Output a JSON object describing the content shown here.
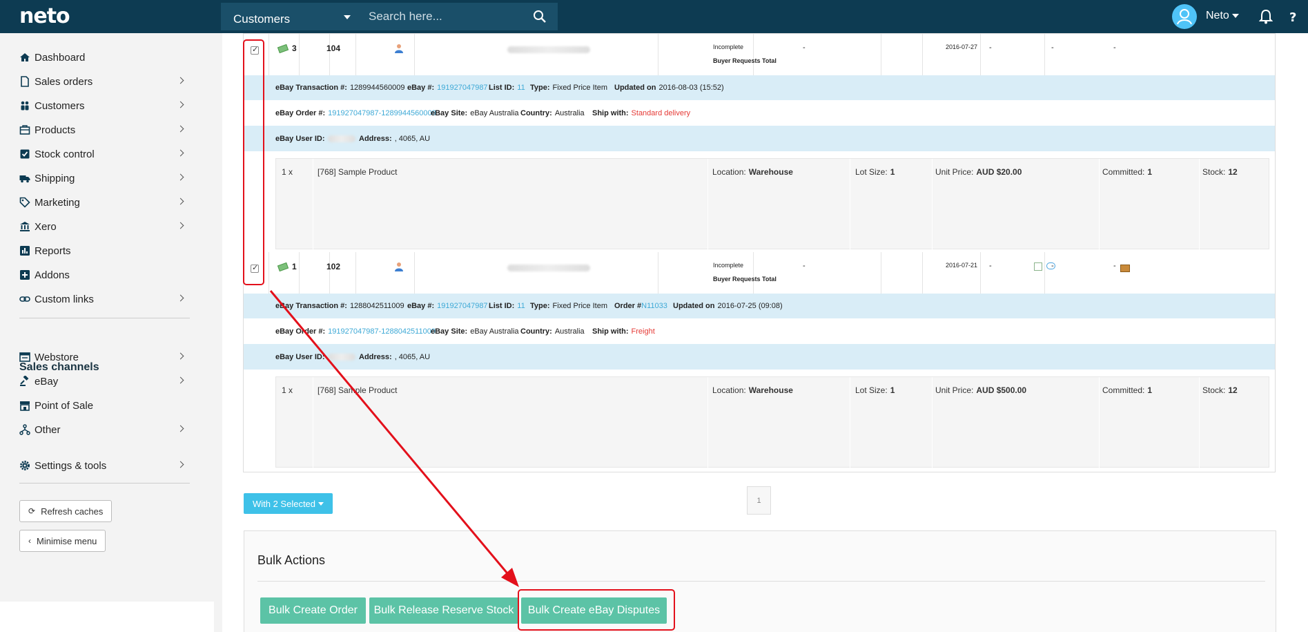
{
  "header": {
    "logo": "neto",
    "dept_select": "Customers",
    "search_placeholder": "Search here...",
    "user_name": "Neto"
  },
  "sidebar": {
    "items": [
      {
        "label": "Dashboard",
        "icon": "home-icon",
        "chevron": false
      },
      {
        "label": "Sales orders",
        "icon": "document-icon",
        "chevron": true
      },
      {
        "label": "Customers",
        "icon": "users-icon",
        "chevron": true
      },
      {
        "label": "Products",
        "icon": "products-icon",
        "chevron": true
      },
      {
        "label": "Stock control",
        "icon": "checkbox-icon",
        "chevron": true
      },
      {
        "label": "Shipping",
        "icon": "truck-icon",
        "chevron": true
      },
      {
        "label": "Marketing",
        "icon": "tag-icon",
        "chevron": true
      },
      {
        "label": "Xero",
        "icon": "bank-icon",
        "chevron": true
      },
      {
        "label": "Reports",
        "icon": "bar-chart-icon",
        "chevron": false
      },
      {
        "label": "Addons",
        "icon": "plus-square-icon",
        "chevron": false
      },
      {
        "label": "Custom links",
        "icon": "link-icon",
        "chevron": true
      }
    ],
    "sales_channels_title": "Sales channels",
    "channels": [
      {
        "label": "Webstore",
        "icon": "webstore-icon",
        "chevron": true
      },
      {
        "label": "eBay",
        "icon": "gavel-icon",
        "chevron": true
      },
      {
        "label": "Point of Sale",
        "icon": "store-icon",
        "chevron": false
      },
      {
        "label": "Other",
        "icon": "network-icon",
        "chevron": true
      }
    ],
    "settings": {
      "label": "Settings & tools",
      "icon": "gear-icon",
      "chevron": true
    },
    "refresh_caches": "Refresh caches",
    "minimise_menu": "Minimise menu"
  },
  "orders": [
    {
      "qty_badge": "3",
      "id": "104",
      "status": "Incomplete",
      "status_sub": "Buyer Requests Total",
      "col_dash1": "-",
      "date": "2016-07-27",
      "col_dash2": "-",
      "col_dash3": "-",
      "col_dash4": "-",
      "detail1": {
        "transaction_label": "eBay Transaction #:",
        "transaction": "1289944560009",
        "ebay_label": "eBay #:",
        "ebay": "191927047987",
        "list_label": "List ID:",
        "list": "11",
        "type_label": "Type:",
        "type": "Fixed Price Item",
        "order_label": "",
        "order": "",
        "updated_label": "Updated on",
        "updated": "2016-08-03 (15:52)"
      },
      "detail2": {
        "order_label": "eBay Order #:",
        "order": "191927047987-1289944560009",
        "site_label": "eBay Site:",
        "site": "eBay Australia",
        "country_label": "Country:",
        "country": "Australia",
        "ship_label": "Ship with:",
        "ship": "Standard delivery"
      },
      "detail3": {
        "user_label": "eBay User ID:",
        "address_label": "Address:",
        "address": ", 4065, AU"
      },
      "line": {
        "qty": "1 x",
        "product": "[768] Sample Product",
        "location_label": "Location:",
        "location": "Warehouse",
        "lot_label": "Lot Size:",
        "lot": "1",
        "price_label": "Unit Price:",
        "price": "AUD $20.00",
        "committed_label": "Committed:",
        "committed": "1",
        "stock_label": "Stock:",
        "stock": "12"
      }
    },
    {
      "qty_badge": "1",
      "id": "102",
      "status": "Incomplete",
      "status_sub": "Buyer Requests Total",
      "col_dash1": "-",
      "date": "2016-07-21",
      "col_dash2": "-",
      "col_dash3": "-",
      "col_dash4": "-",
      "detail1": {
        "transaction_label": "eBay Transaction #:",
        "transaction": "1288042511009",
        "ebay_label": "eBay #:",
        "ebay": "191927047987",
        "list_label": "List ID:",
        "list": "11",
        "type_label": "Type:",
        "type": "Fixed Price Item",
        "order_label": "Order #",
        "order": "N11033",
        "updated_label": "Updated on",
        "updated": "2016-07-25 (09:08)"
      },
      "detail2": {
        "order_label": "eBay Order #:",
        "order": "191927047987-1288042511009",
        "site_label": "eBay Site:",
        "site": "eBay Australia",
        "country_label": "Country:",
        "country": "Australia",
        "ship_label": "Ship with:",
        "ship": "Freight"
      },
      "detail3": {
        "user_label": "eBay User ID:",
        "address_label": "Address:",
        "address": ", 4065, AU"
      },
      "line": {
        "qty": "1 x",
        "product": "[768] Sample Product",
        "location_label": "Location:",
        "location": "Warehouse",
        "lot_label": "Lot Size:",
        "lot": "1",
        "price_label": "Unit Price:",
        "price": "AUD $500.00",
        "committed_label": "Committed:",
        "committed": "1",
        "stock_label": "Stock:",
        "stock": "12"
      }
    }
  ],
  "with_selected": "With 2 Selected",
  "page_number": "1",
  "bulk": {
    "title": "Bulk Actions",
    "create_order": "Bulk Create Order",
    "release_stock": "Bulk Release Reserve Stock",
    "create_disputes": "Bulk Create eBay Disputes"
  },
  "colors": {
    "topbar": "#0d3b52",
    "accent_blue": "#3ec1e8",
    "bulk_green": "#5cc3a6",
    "annotation_red": "#e3101b"
  }
}
